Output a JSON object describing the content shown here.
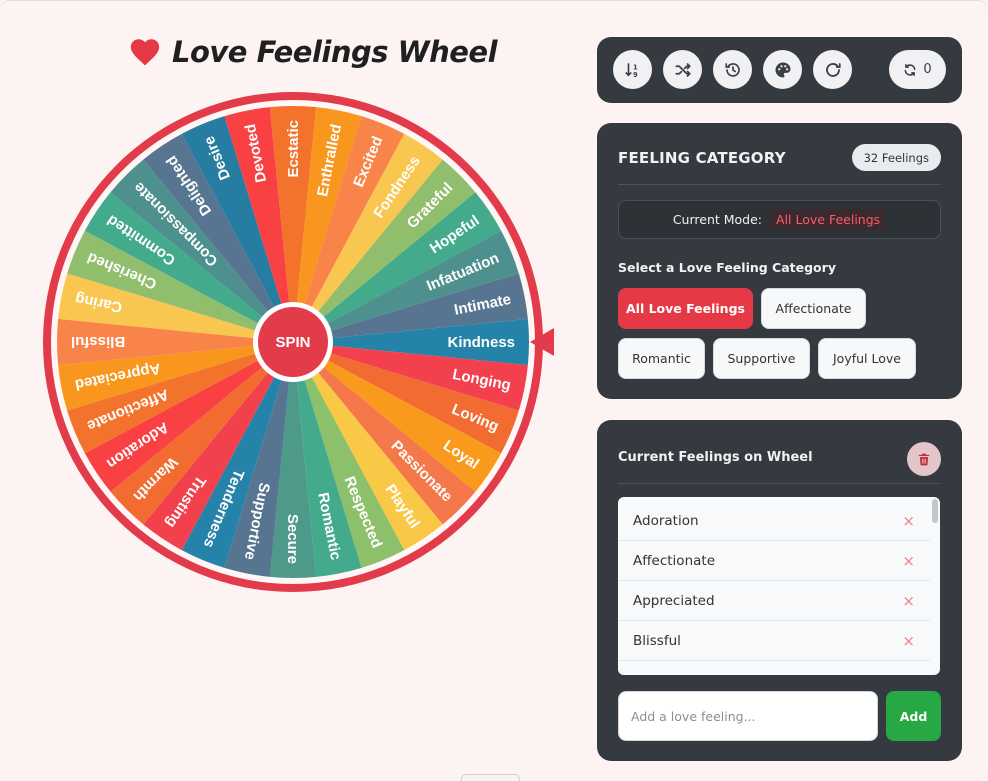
{
  "title": "Love Feelings Wheel",
  "icons": {
    "title": "heart-icon",
    "sort": "sort-numeric-icon",
    "shuffle": "shuffle-icon",
    "history": "history-icon",
    "theme": "palette-icon",
    "redo": "redo-icon",
    "reset": "sync-icon",
    "clear": "trash-icon",
    "remove": "close-icon"
  },
  "wheel": {
    "spin_label": "SPIN",
    "segments": [
      {
        "label": "Kindness",
        "color": "#2582a8"
      },
      {
        "label": "Longing",
        "color": "#f2414c"
      },
      {
        "label": "Loving",
        "color": "#f26b31"
      },
      {
        "label": "Loyal",
        "color": "#f99a1c"
      },
      {
        "label": "Passionate",
        "color": "#f4784a"
      },
      {
        "label": "Playful",
        "color": "#f9c846"
      },
      {
        "label": "Respected",
        "color": "#8cc06b"
      },
      {
        "label": "Romantic",
        "color": "#43aa8b"
      },
      {
        "label": "Secure",
        "color": "#4d9a8b"
      },
      {
        "label": "Supportive",
        "color": "#577590"
      },
      {
        "label": "Tenderness",
        "color": "#2582a8"
      },
      {
        "label": "Trusting",
        "color": "#f2414c"
      },
      {
        "label": "Warmth",
        "color": "#f26b31"
      },
      {
        "label": "Adoration",
        "color": "#f94144"
      },
      {
        "label": "Affectionate",
        "color": "#f3722c"
      },
      {
        "label": "Appreciated",
        "color": "#f8961e"
      },
      {
        "label": "Blissful",
        "color": "#f9844a"
      },
      {
        "label": "Caring",
        "color": "#f9c74f"
      },
      {
        "label": "Cherished",
        "color": "#90be6d"
      },
      {
        "label": "Committed",
        "color": "#43aa8b"
      },
      {
        "label": "Compassionate",
        "color": "#4d908e"
      },
      {
        "label": "Delighted",
        "color": "#577590"
      },
      {
        "label": "Desire",
        "color": "#277da1"
      },
      {
        "label": "Devoted",
        "color": "#f94144"
      },
      {
        "label": "Ecstatic",
        "color": "#f3722c"
      },
      {
        "label": "Enthralled",
        "color": "#f8961e"
      },
      {
        "label": "Excited",
        "color": "#f9844a"
      },
      {
        "label": "Fondness",
        "color": "#f9c74f"
      },
      {
        "label": "Grateful",
        "color": "#90be6d"
      },
      {
        "label": "Hopeful",
        "color": "#43aa8b"
      },
      {
        "label": "Infatuation",
        "color": "#4d908e"
      },
      {
        "label": "Intimate",
        "color": "#577590"
      }
    ]
  },
  "toolbar": {
    "count": "0"
  },
  "category": {
    "title": "FEELING CATEGORY",
    "badge": "32 Feelings",
    "mode_label": "Current Mode:",
    "mode_value": "All Love Feelings",
    "select_label": "Select a Love Feeling Category",
    "chips": [
      "All Love Feelings",
      "Affectionate",
      "Romantic",
      "Supportive",
      "Joyful Love"
    ],
    "active_chip": "All Love Feelings"
  },
  "feelings": {
    "title": "Current Feelings on Wheel",
    "items": [
      "Adoration",
      "Affectionate",
      "Appreciated",
      "Blissful"
    ],
    "remove_symbol": "×",
    "input_placeholder": "Add a love feeling...",
    "add_label": "Add"
  },
  "colors": {
    "accent": "#e63946",
    "panel": "#343a40",
    "add_button": "#28a745",
    "background": "#fdf3f3"
  }
}
